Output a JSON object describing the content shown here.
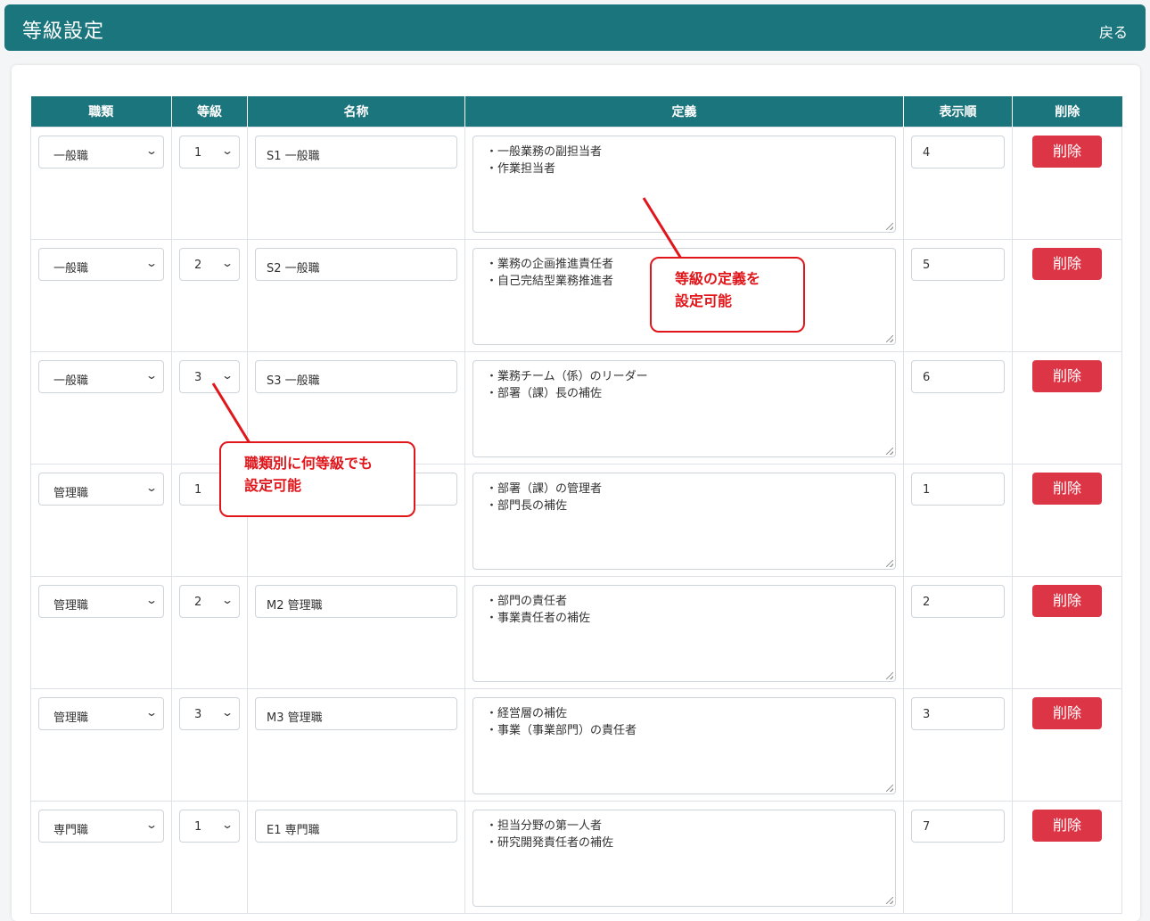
{
  "header": {
    "title": "等級設定",
    "back_label": "戻る"
  },
  "table": {
    "headers": [
      "職類",
      "等級",
      "名称",
      "定義",
      "表示順",
      "削除"
    ],
    "rows": [
      {
        "category": "一般職",
        "grade": "1",
        "name": "S1 一般職",
        "def1": "・一般業務の副担当者",
        "def2": "・作業担当者",
        "order": "4",
        "delete": "削除"
      },
      {
        "category": "一般職",
        "grade": "2",
        "name": "S2 一般職",
        "def1": "・業務の企画推進責任者",
        "def2": "・自己完結型業務推進者",
        "order": "5",
        "delete": "削除"
      },
      {
        "category": "一般職",
        "grade": "3",
        "name": "S3 一般職",
        "def1": "・業務チーム（係）のリーダー",
        "def2": "・部署（課）長の補佐",
        "order": "6",
        "delete": "削除"
      },
      {
        "category": "管理職",
        "grade": "1",
        "name": "",
        "def1": "・部署（課）の管理者",
        "def2": "・部門長の補佐",
        "order": "1",
        "delete": "削除"
      },
      {
        "category": "管理職",
        "grade": "2",
        "name": "M2 管理職",
        "def1": "・部門の責任者",
        "def2": "・事業責任者の補佐",
        "order": "2",
        "delete": "削除"
      },
      {
        "category": "管理職",
        "grade": "3",
        "name": "M3 管理職",
        "def1": "・経営層の補佐",
        "def2": "・事業（事業部門）の責任者",
        "order": "3",
        "delete": "削除"
      },
      {
        "category": "専門職",
        "grade": "1",
        "name": "E1 専門職",
        "def1": "・担当分野の第一人者",
        "def2": "・研究開発責任者の補佐",
        "order": "7",
        "delete": "削除"
      }
    ]
  },
  "callouts": {
    "definition": {
      "line1": "等級の定義を",
      "line2": "設定可能"
    },
    "grades": {
      "line1": "職類別に何等級でも",
      "line2": "設定可能"
    }
  },
  "colors": {
    "header": "#1b757c",
    "delete": "#dc3545",
    "callout": "#e0161b"
  }
}
